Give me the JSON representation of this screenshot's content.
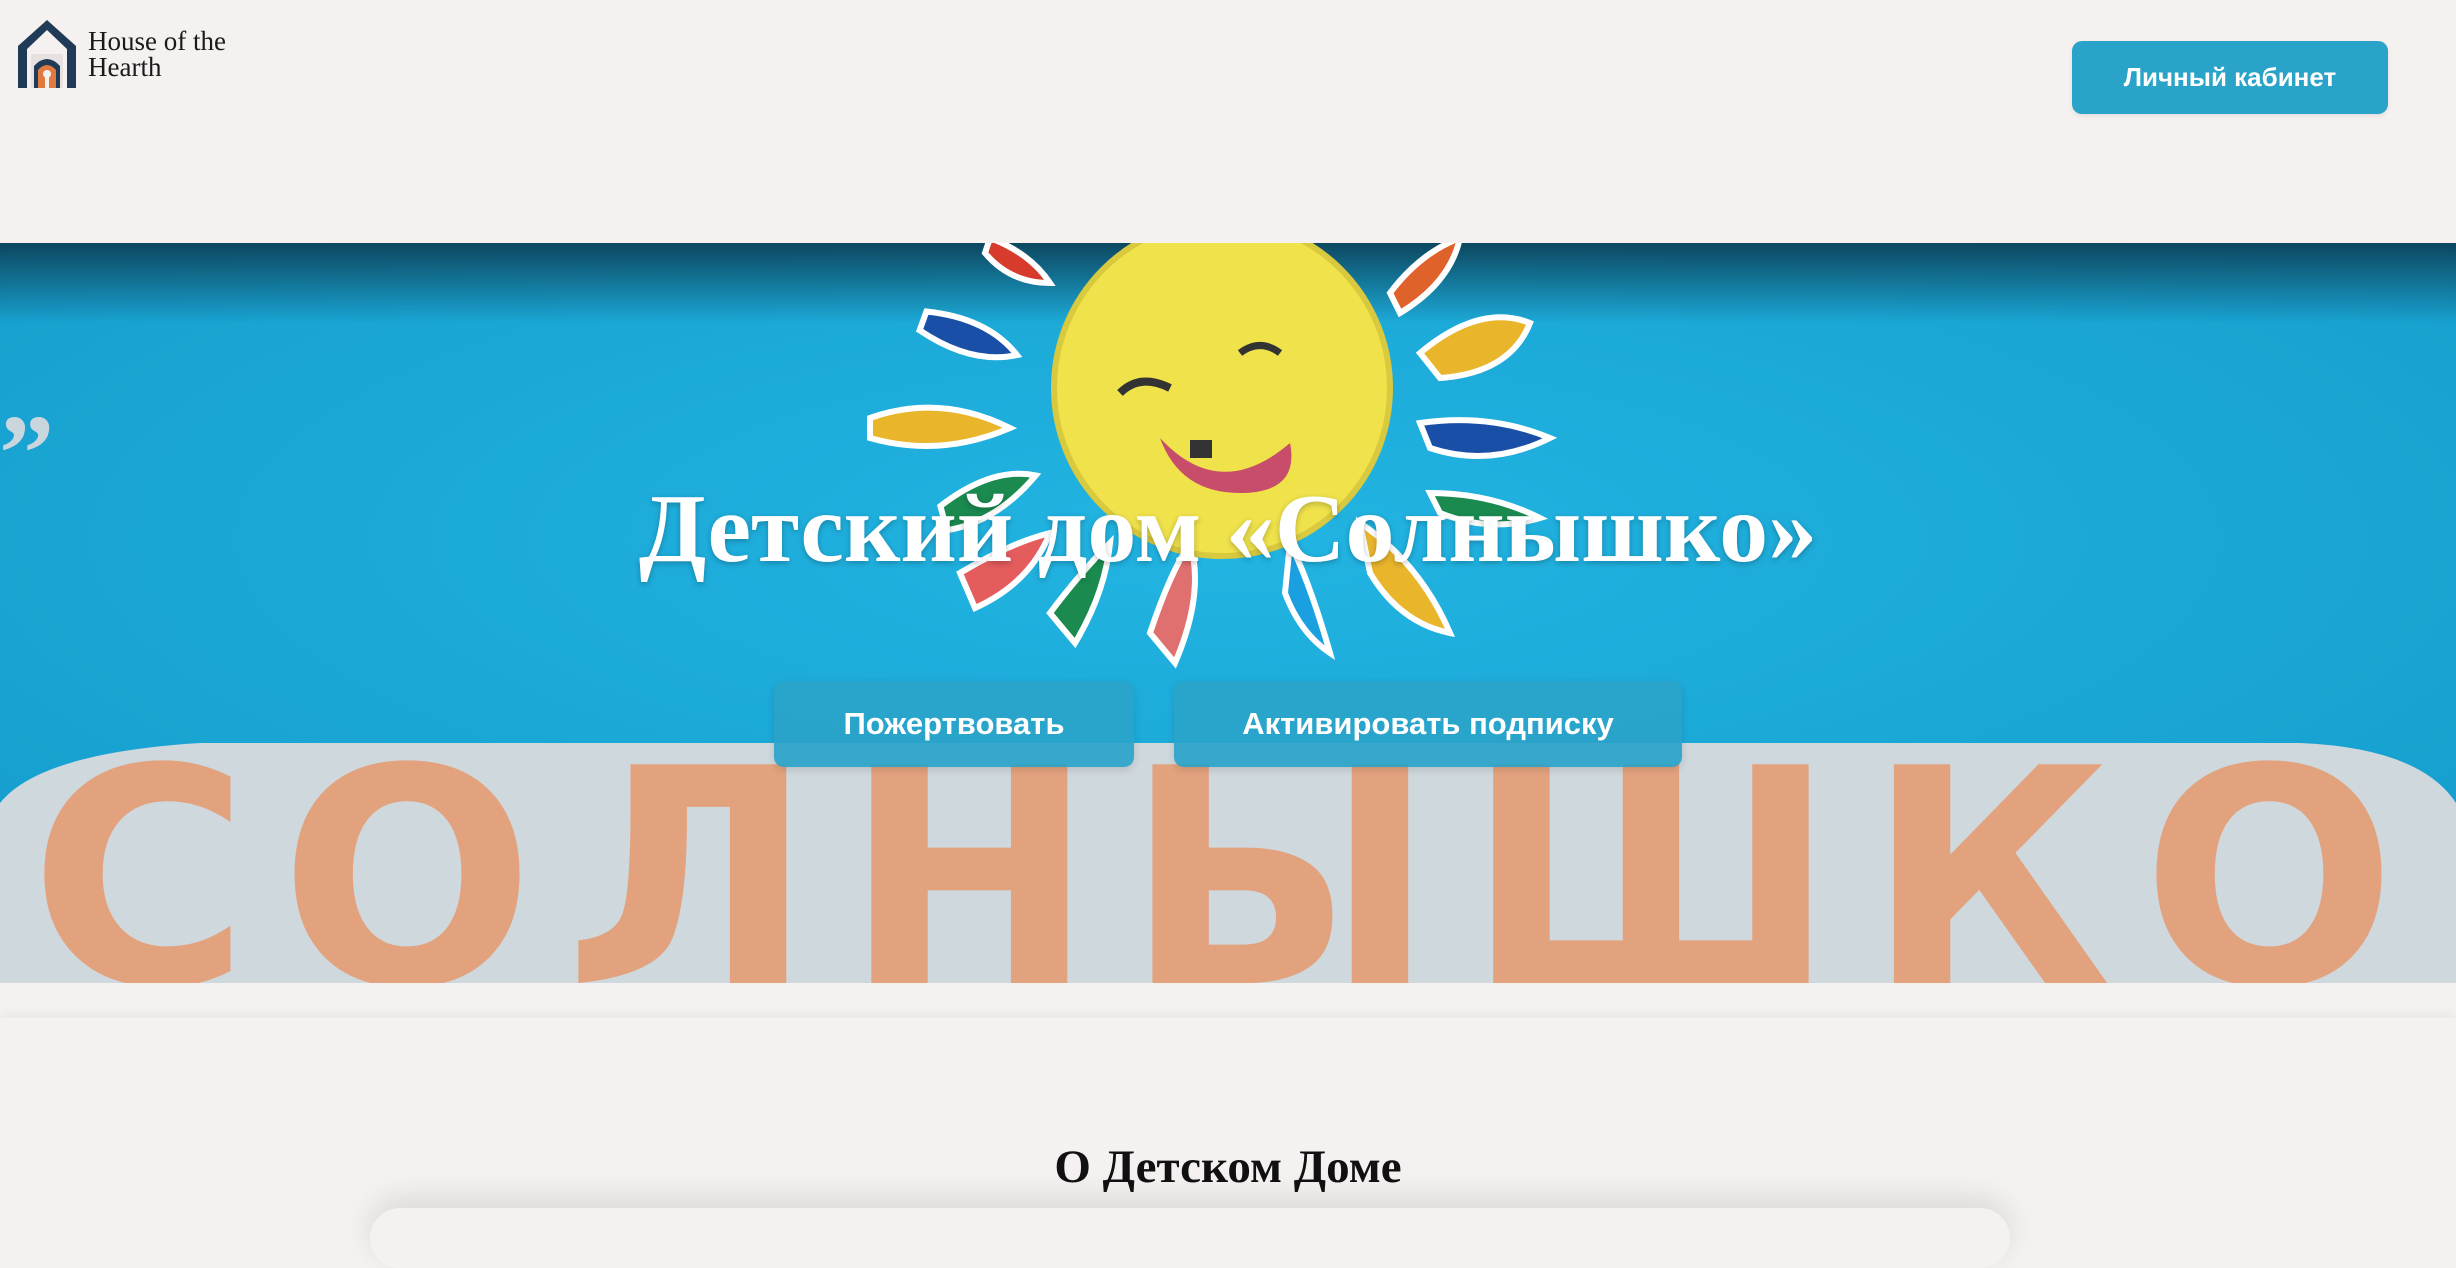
{
  "header": {
    "logo_line1": "House of the",
    "logo_line2": "Hearth",
    "cabinet_button": "Личный кабинет"
  },
  "hero": {
    "title": "Детский дом «Солнышко»",
    "donate_button": "Пожертвовать",
    "subscribe_button": "Активировать подписку",
    "sign_text": "СОЛНЫШКО"
  },
  "about": {
    "title": "О Детском Доме"
  },
  "colors": {
    "accent": "#2aa3c9",
    "background": "#f5f1f0",
    "hero_blue": "#1eaedc"
  }
}
